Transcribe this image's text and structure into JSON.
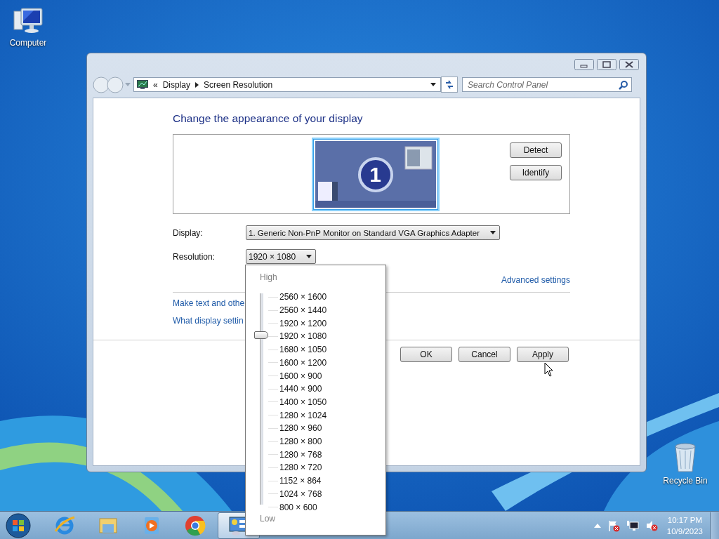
{
  "desktop_icons": [
    {
      "label": "Computer",
      "kind": "computer"
    },
    {
      "label": "Recycle Bin",
      "kind": "bin"
    }
  ],
  "window": {
    "breadcrumb_prefix": "«",
    "breadcrumb": [
      "Display",
      "Screen Resolution"
    ],
    "search": {
      "placeholder": "Search Control Panel"
    },
    "heading": "Change the appearance of your display",
    "monitor": {
      "number": "1"
    },
    "side_buttons": [
      "Detect",
      "Identify"
    ],
    "fields": [
      {
        "label": "Display:",
        "value": "1. Generic Non-PnP Monitor on Standard VGA Graphics Adapter",
        "kind": "wide"
      },
      {
        "label": "Resolution:",
        "value": "1920 × 1080",
        "kind": "narrow"
      }
    ],
    "advanced_link": "Advanced settings",
    "links": [
      "Make text and othe",
      "What display settin"
    ],
    "buttons": [
      "OK",
      "Cancel",
      "Apply"
    ]
  },
  "resolution_dropdown": {
    "high_label": "High",
    "low_label": "Low",
    "slider": {
      "level": 0.8125
    },
    "options": [
      "2560 × 1600",
      "2560 × 1440",
      "1920 × 1200",
      "1920 × 1080",
      "1680 × 1050",
      "1600 × 1200",
      "1600 × 900",
      "1440 × 900",
      "1400 × 1050",
      "1280 × 1024",
      "1280 × 960",
      "1280 × 800",
      "1280 × 768",
      "1280 × 720",
      "1152 × 864",
      "1024 × 768",
      "800 × 600"
    ]
  },
  "taskbar": {
    "apps": [
      {
        "kind": "ie",
        "active": false
      },
      {
        "kind": "folder",
        "active": false
      },
      {
        "kind": "media",
        "active": false
      },
      {
        "kind": "chrome",
        "active": false
      },
      {
        "kind": "panel",
        "active": true
      }
    ],
    "clock": {
      "time": "10:17 PM",
      "date": "10/9/2023"
    }
  }
}
